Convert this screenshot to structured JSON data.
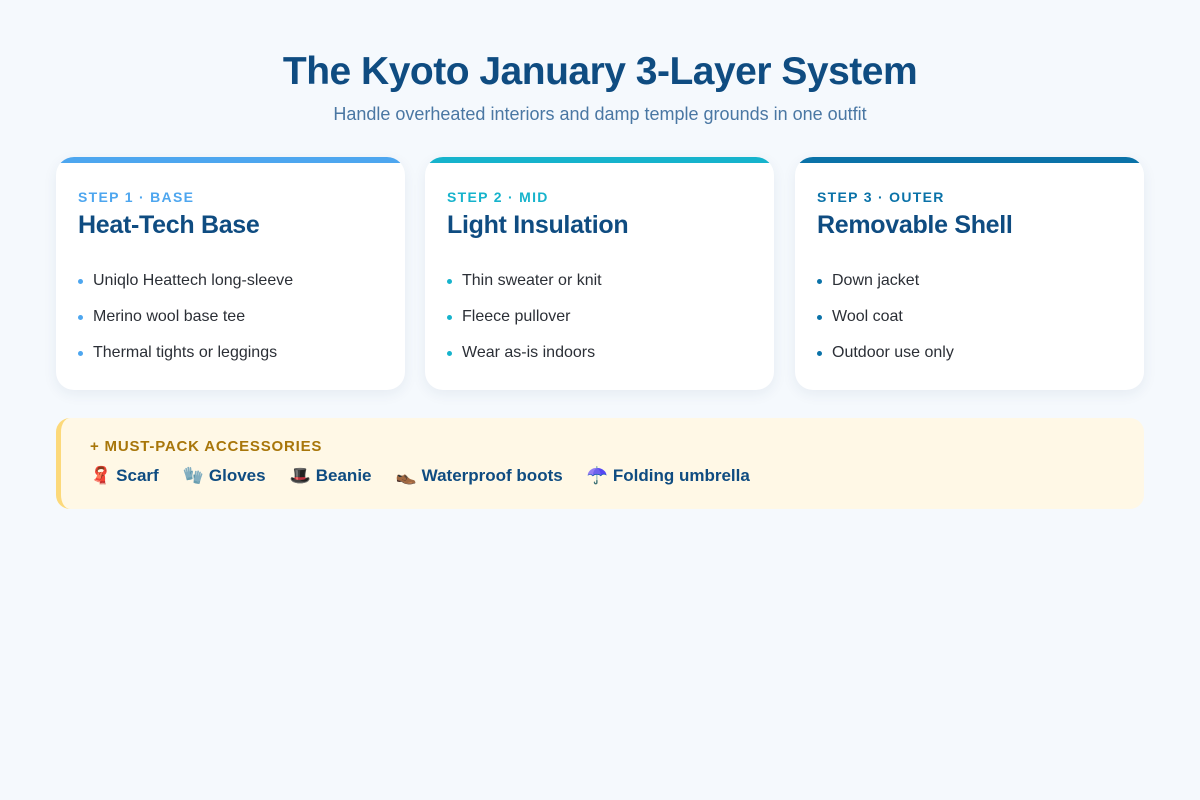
{
  "header": {
    "title": "The Kyoto January 3-Layer System",
    "subtitle": "Handle overheated interiors and damp temple grounds in one outfit"
  },
  "layers": [
    {
      "step": "STEP 1 · BASE",
      "heading": "Heat-Tech Base",
      "color": "#4da6ef",
      "items": [
        "Uniqlo Heattech long-sleeve",
        "Merino wool base tee",
        "Thermal tights or leggings"
      ]
    },
    {
      "step": "STEP 2 · MID",
      "heading": "Light Insulation",
      "color": "#16b3cc",
      "items": [
        "Thin sweater or knit",
        "Fleece pullover",
        "Wear as-is indoors"
      ]
    },
    {
      "step": "STEP 3 · OUTER",
      "heading": "Removable Shell",
      "color": "#0a72a8",
      "items": [
        "Down jacket",
        "Wool coat",
        "Outdoor use only"
      ]
    }
  ],
  "accessories": {
    "title": "+ MUST-PACK ACCESSORIES",
    "items": [
      {
        "icon": "scarf-icon",
        "glyph": "🧣",
        "label": "Scarf"
      },
      {
        "icon": "gloves-icon",
        "glyph": "🧤",
        "label": "Gloves"
      },
      {
        "icon": "hat-icon",
        "glyph": "🎩",
        "label": "Beanie"
      },
      {
        "icon": "boot-icon",
        "glyph": "👞",
        "label": "Waterproof boots"
      },
      {
        "icon": "umbrella-icon",
        "glyph": "☂️",
        "label": "Folding umbrella"
      }
    ]
  }
}
